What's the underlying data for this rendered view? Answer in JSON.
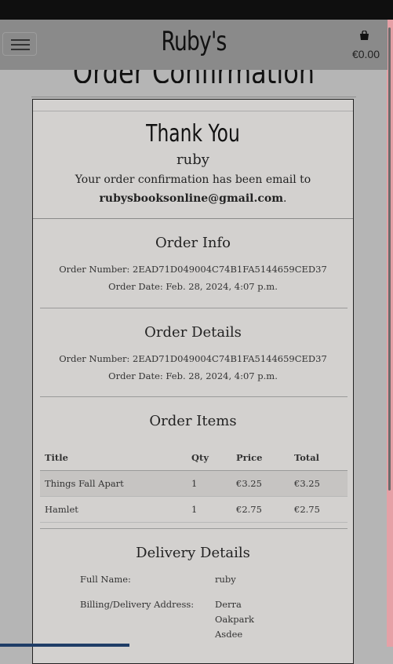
{
  "nav": {
    "brand": "Ruby's",
    "cart_total": "€0.00"
  },
  "page": {
    "heading": "Order Confirmation"
  },
  "thanks": {
    "title": "Thank You",
    "name": "ruby",
    "message": "Your order confirmation has been email to",
    "email": "rubysbooksonline@gmail.com",
    "email_suffix": "."
  },
  "order_info": {
    "title": "Order Info",
    "number_line": "Order Number: 2EAD71D049004C74B1FA5144659CED37",
    "date_line": "Order Date: Feb. 28, 2024, 4:07 p.m."
  },
  "order_details": {
    "title": "Order Details",
    "number_line": "Order Number: 2EAD71D049004C74B1FA5144659CED37",
    "date_line": "Order Date: Feb. 28, 2024, 4:07 p.m."
  },
  "order_items": {
    "title": "Order Items",
    "columns": [
      "Title",
      "Qty",
      "Price",
      "Total"
    ],
    "rows": [
      [
        "Things Fall Apart",
        "1",
        "€3.25",
        "€3.25"
      ],
      [
        "Hamlet",
        "1",
        "€2.75",
        "€2.75"
      ]
    ]
  },
  "delivery": {
    "title": "Delivery Details",
    "full_name_label": "Full Name:",
    "full_name": "ruby",
    "address_label": "Billing/Delivery Address:",
    "address_lines": [
      "Derra",
      "Oakpark",
      "Asdee"
    ]
  },
  "colors": {
    "topbar": "#0f0f0f",
    "navbar": "#8a8a8a",
    "card": "#d3d1cf",
    "background": "#b5b5b5"
  }
}
